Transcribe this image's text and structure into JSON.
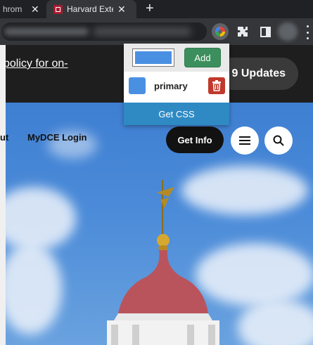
{
  "browser": {
    "tabs": [
      {
        "title": "hrom",
        "close": "✕"
      },
      {
        "title": "Harvard Exte",
        "close": "✕"
      }
    ],
    "new_tab_label": "+"
  },
  "page": {
    "banner_link": "policy for on-",
    "updates_button": "9 Updates",
    "nav_partial": "ut",
    "nav_login": "MyDCE Login",
    "get_info_button": "Get Info"
  },
  "popup": {
    "selected_color": "#4a90e2",
    "add_button": "Add",
    "saved_colors": [
      {
        "name": "primary",
        "color": "#4a90e2"
      }
    ],
    "get_css_button": "Get CSS"
  },
  "colors": {
    "add_green": "#3c8f5c",
    "delete_red": "#c0392b",
    "get_css_blue": "#2f8ac4",
    "sky_blue": "#4b8bd8"
  }
}
